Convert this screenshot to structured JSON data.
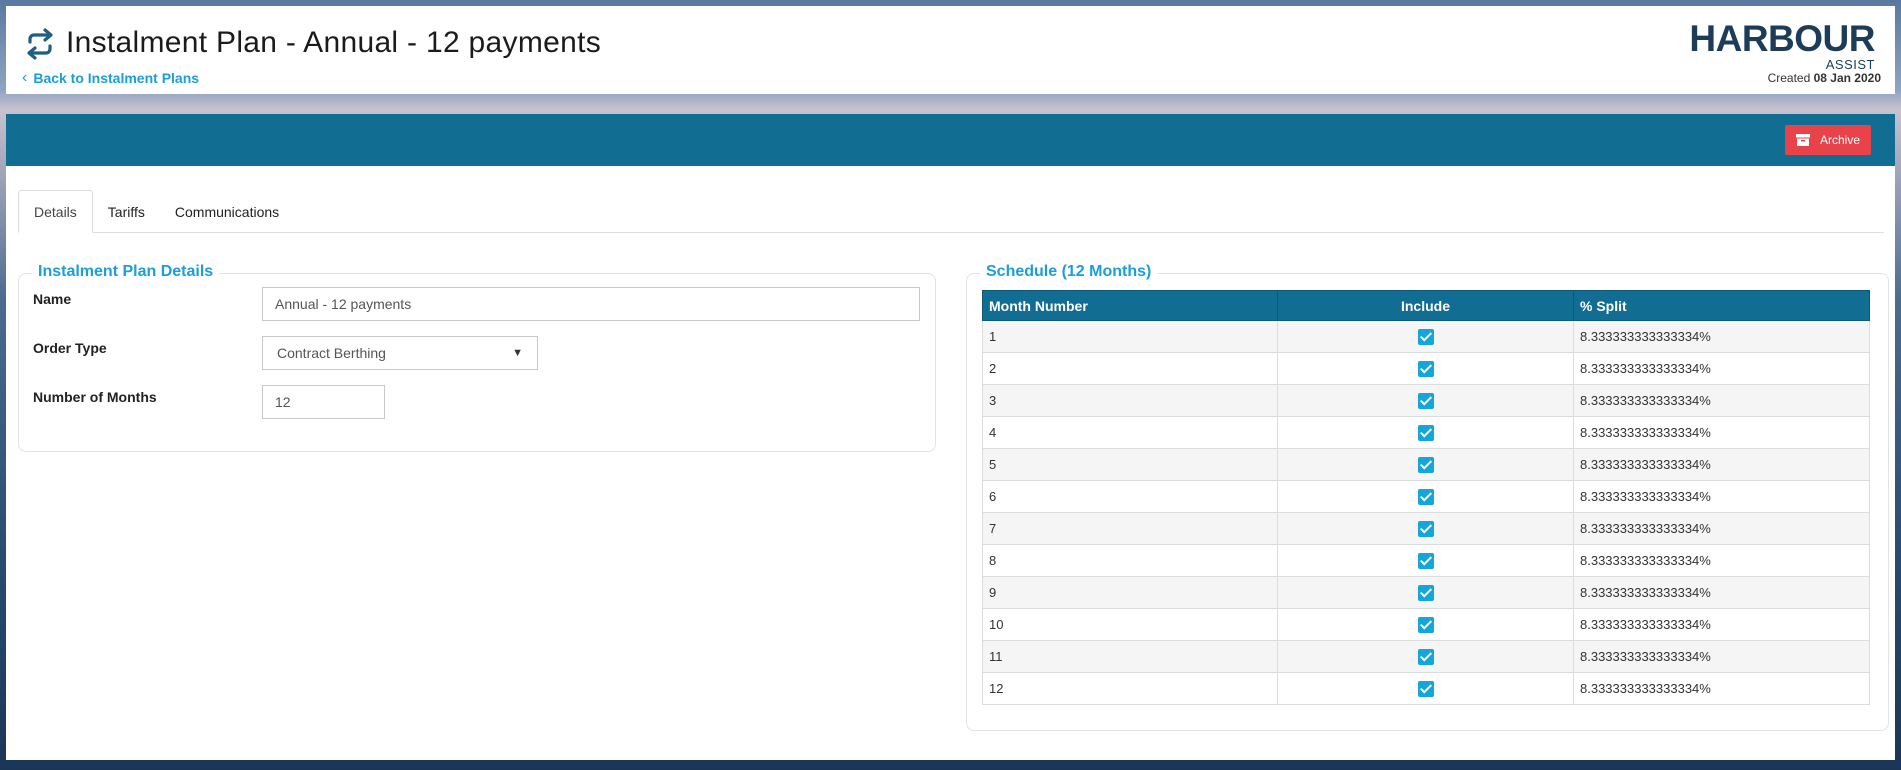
{
  "header": {
    "title": "Instalment Plan - Annual - 12 payments",
    "back_link": "Back to Instalment Plans",
    "logo_main": "HARBOUR",
    "logo_sub": "ASSIST",
    "created_label": "Created",
    "created_date": "08 Jan 2020"
  },
  "toolbar": {
    "archive_label": "Archive",
    "archive_color": "#e8424a",
    "bar_color": "#116e92"
  },
  "tabs": [
    {
      "label": "Details",
      "active": true
    },
    {
      "label": "Tariffs",
      "active": false
    },
    {
      "label": "Communications",
      "active": false
    }
  ],
  "details": {
    "legend": "Instalment Plan Details",
    "name_label": "Name",
    "name_value": "Annual - 12 payments",
    "order_type_label": "Order Type",
    "order_type_value": "Contract Berthing",
    "months_label": "Number of Months",
    "months_value": "12"
  },
  "schedule": {
    "legend": "Schedule (12 Months)",
    "columns": [
      "Month Number",
      "Include",
      "% Split"
    ],
    "rows": [
      {
        "month": "1",
        "include": true,
        "split": "8.333333333333334%"
      },
      {
        "month": "2",
        "include": true,
        "split": "8.333333333333334%"
      },
      {
        "month": "3",
        "include": true,
        "split": "8.333333333333334%"
      },
      {
        "month": "4",
        "include": true,
        "split": "8.333333333333334%"
      },
      {
        "month": "5",
        "include": true,
        "split": "8.333333333333334%"
      },
      {
        "month": "6",
        "include": true,
        "split": "8.333333333333334%"
      },
      {
        "month": "7",
        "include": true,
        "split": "8.333333333333334%"
      },
      {
        "month": "8",
        "include": true,
        "split": "8.333333333333334%"
      },
      {
        "month": "9",
        "include": true,
        "split": "8.333333333333334%"
      },
      {
        "month": "10",
        "include": true,
        "split": "8.333333333333334%"
      },
      {
        "month": "11",
        "include": true,
        "split": "8.333333333333334%"
      },
      {
        "month": "12",
        "include": true,
        "split": "8.333333333333334%"
      }
    ]
  },
  "colors": {
    "accent": "#1a9fd8",
    "checkbox": "#12a6dc"
  }
}
